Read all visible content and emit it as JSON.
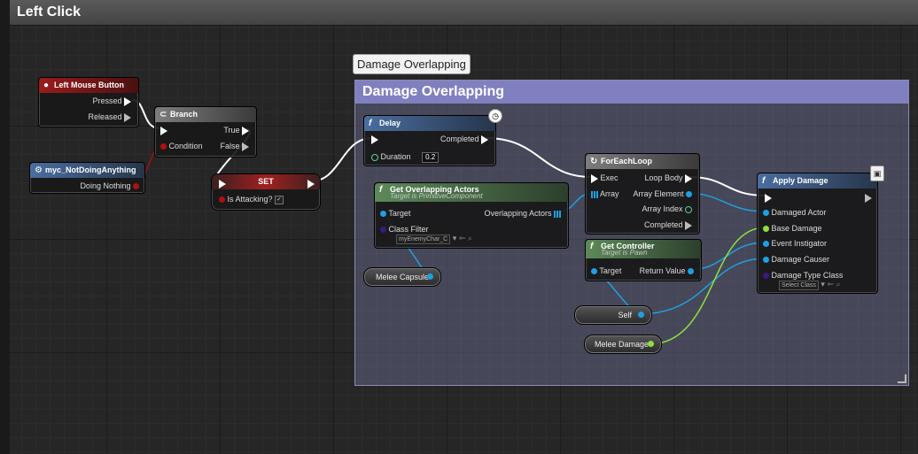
{
  "window": {
    "title": "Left Click"
  },
  "comment": {
    "bubble": "Damage Overlapping",
    "title": "Damage Overlapping"
  },
  "nodes": {
    "left_mouse_button": {
      "title": "Left Mouse Button",
      "pins": [
        "Pressed",
        "Released"
      ]
    },
    "branch": {
      "title": "Branch",
      "pins": [
        "True",
        "Condition",
        "False"
      ]
    },
    "myc_not_doing_anything": {
      "title": "myc_NotDoingAnything",
      "pins": [
        "Doing Nothing"
      ]
    },
    "set": {
      "title": "SET",
      "pins": [
        "Is Attacking?"
      ]
    },
    "delay": {
      "title": "Delay",
      "pins": [
        "Completed",
        "Duration"
      ],
      "duration_value": "0.2"
    },
    "get_overlapping_actors": {
      "title": "Get Overlapping Actors",
      "subtitle": "Target is PrimitiveComponent",
      "pins": [
        "Target",
        "Overlapping Actors",
        "Class Filter"
      ],
      "class_filter_value": "myEnemyChar_C"
    },
    "for_each_loop": {
      "title": "ForEachLoop",
      "pins": [
        "Exec",
        "Loop Body",
        "Array",
        "Array Element",
        "Array Index",
        "Completed"
      ]
    },
    "get_controller": {
      "title": "Get Controller",
      "subtitle": "Target is Pawn",
      "pins": [
        "Target",
        "Return Value"
      ]
    },
    "apply_damage": {
      "title": "Apply Damage",
      "pins": [
        "Damaged Actor",
        "Base Damage",
        "Event Instigator",
        "Damage Causer",
        "Damage Type Class"
      ],
      "damage_type_value": "Select Class"
    }
  },
  "variables": {
    "melee_capsule": "Melee Capsule",
    "self": "Self",
    "melee_damage": "Melee Damage"
  },
  "colors": {
    "exec_wire": "#ffffff",
    "object_wire": "#1ea0e0",
    "float_wire": "#8ee040",
    "bool_wire": "#a01010",
    "comment_header": "#8080c0"
  }
}
